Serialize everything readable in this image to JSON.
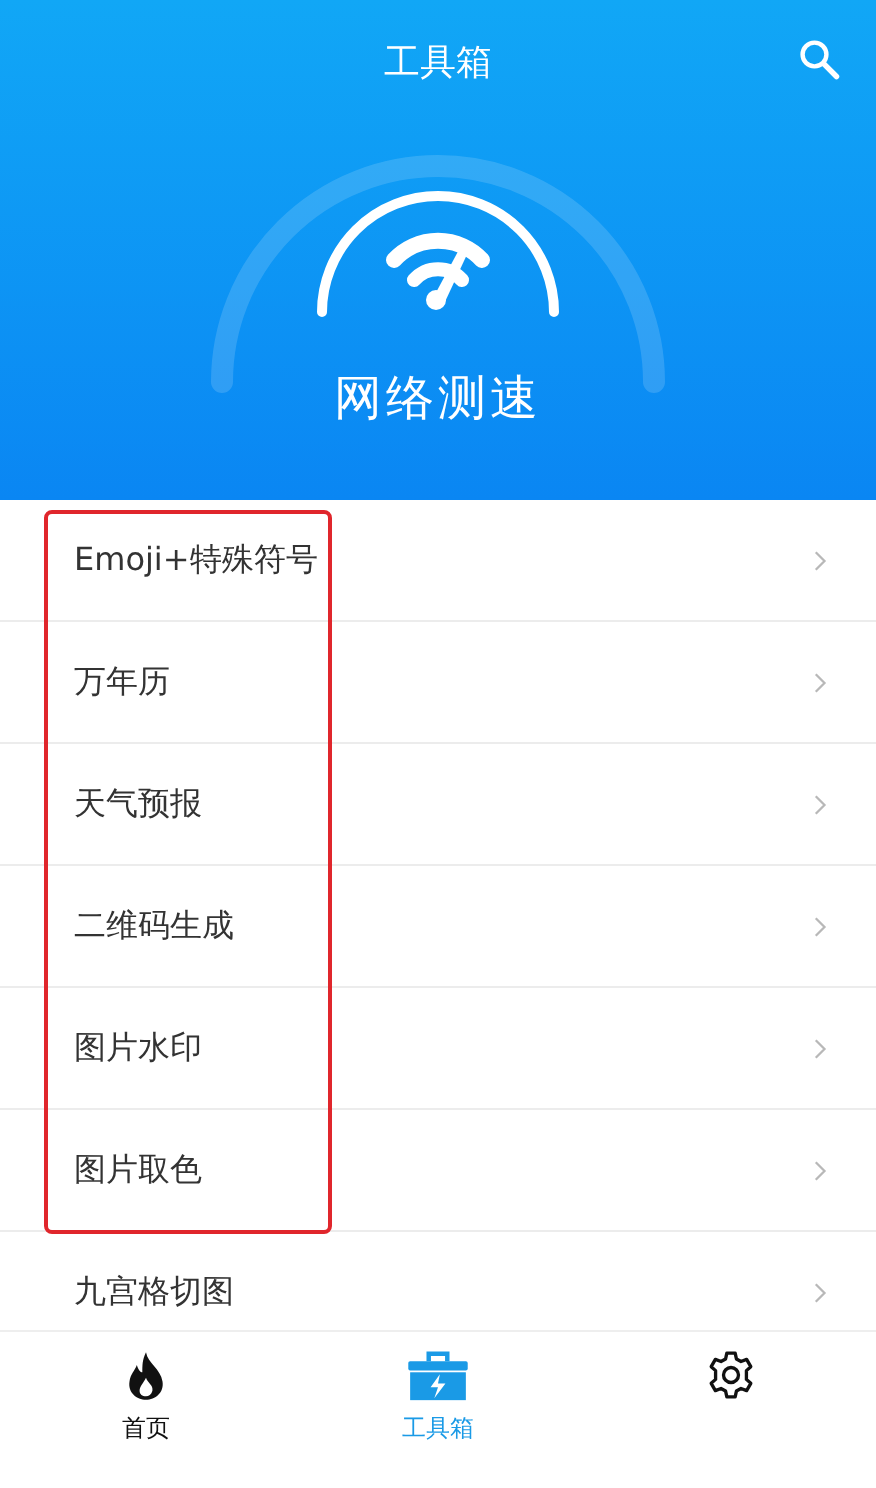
{
  "header": {
    "title": "工具箱",
    "speed_test_label": "网络测速"
  },
  "tools": [
    {
      "label": "Emoji+特殊符号",
      "highlighted": true
    },
    {
      "label": "万年历",
      "highlighted": true
    },
    {
      "label": "天气预报",
      "highlighted": true
    },
    {
      "label": "二维码生成",
      "highlighted": true
    },
    {
      "label": "图片水印",
      "highlighted": true
    },
    {
      "label": "图片取色",
      "highlighted": true
    },
    {
      "label": "九宫格切图",
      "highlighted": false
    }
  ],
  "tab_bar": [
    {
      "kind": "fire",
      "label": "首页",
      "selected": false
    },
    {
      "kind": "toolbox",
      "label": "工具箱",
      "selected": true
    },
    {
      "kind": "gear",
      "selected": false
    }
  ]
}
